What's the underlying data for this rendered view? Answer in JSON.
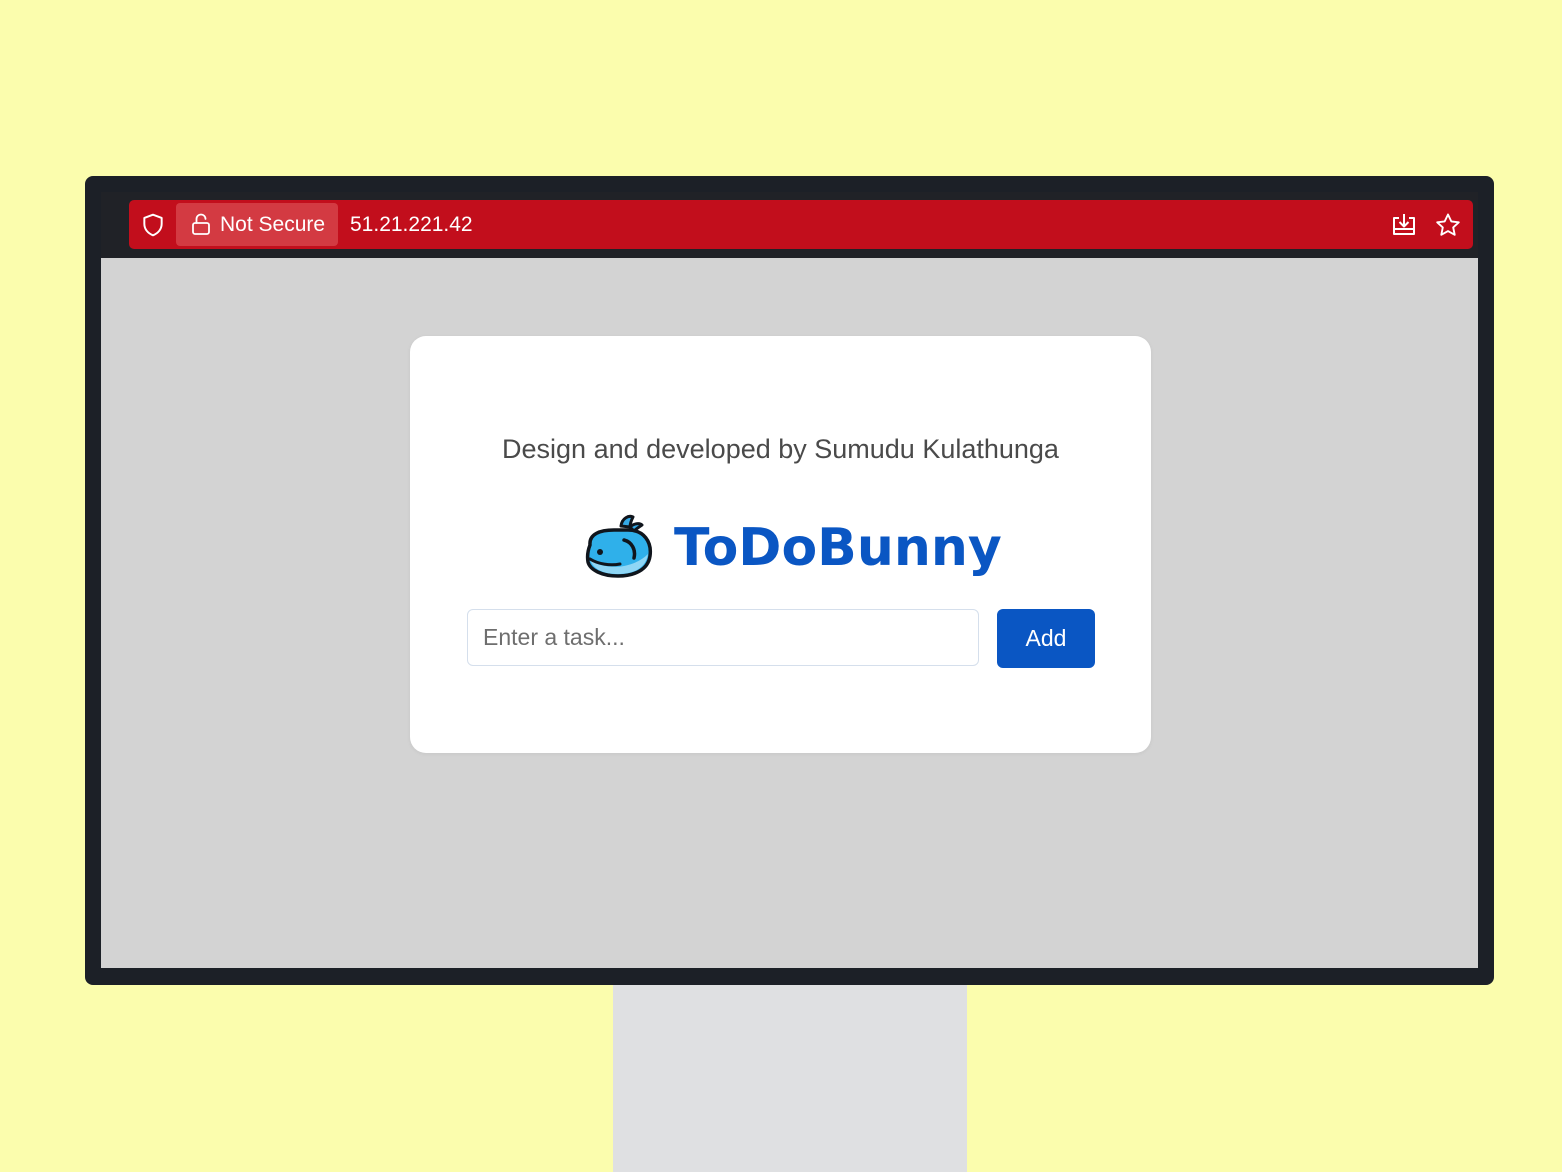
{
  "browser": {
    "security_label": "Not Secure",
    "url": "51.21.221.42",
    "colors": {
      "address_bar": "#c20e1c",
      "security_chip": "#d33a42"
    },
    "icons": [
      "shield-icon",
      "lock-icon",
      "download-icon",
      "star-icon"
    ]
  },
  "page": {
    "credit": "Design and developed by Sumudu Kulathunga",
    "brand": {
      "name": "ToDoBunny",
      "logo_icon": "whale-logo-icon",
      "color": "#0a56c3"
    },
    "task_input": {
      "placeholder": "Enter a task...",
      "value": ""
    },
    "add_button": {
      "label": "Add",
      "color": "#0a56c3"
    }
  },
  "colors": {
    "background": "#fbfdad",
    "monitor_frame": "#1c2027",
    "page_background": "#d3d3d3",
    "card": "#ffffff"
  }
}
